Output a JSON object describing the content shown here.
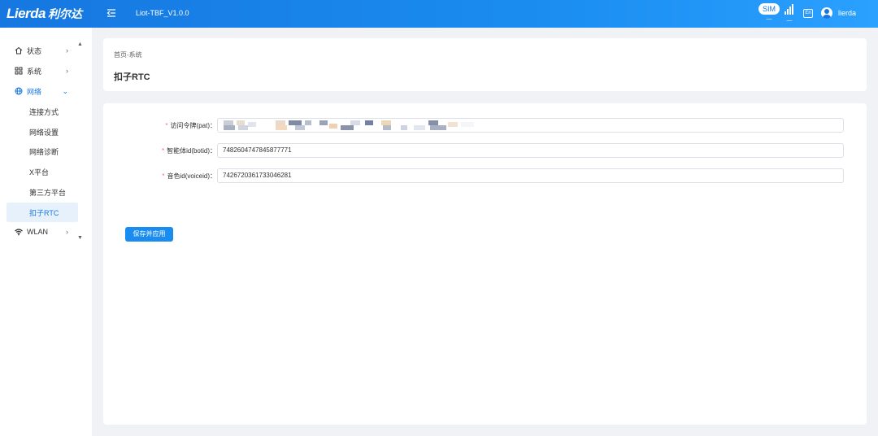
{
  "brand": {
    "logo_en": "Lierda",
    "logo_cn": "利尔达"
  },
  "header": {
    "app_version": "Liot-TBF_V1.0.0",
    "sim_label": "SIM",
    "sim_value": "—",
    "signal_value": "—",
    "lang_label": "En",
    "username": "lierda"
  },
  "sidebar": {
    "items": [
      {
        "label": "状态",
        "icon": "home-icon",
        "arrow": "›"
      },
      {
        "label": "系统",
        "icon": "grid-icon",
        "arrow": "›"
      },
      {
        "label": "网络",
        "icon": "globe-icon",
        "arrow": "⌄",
        "expanded": true
      },
      {
        "label": "WLAN",
        "icon": "wifi-icon",
        "arrow": "›"
      }
    ],
    "sub_items": [
      "连接方式",
      "网络设置",
      "网络诊断",
      "X平台",
      "第三方平台",
      "扣子RTC"
    ],
    "active_sub": "扣子RTC",
    "scroll_up": "▲",
    "scroll_down": "▼"
  },
  "page": {
    "breadcrumb": "首页-系统",
    "title": "扣子RTC"
  },
  "form": {
    "fields": [
      {
        "label": "访问令牌(pat)：",
        "required": true,
        "value": "",
        "redacted": true
      },
      {
        "label": "智能体id(botid)：",
        "required": true,
        "value": "7482604747845877771"
      },
      {
        "label": "音色id(voiceid)：",
        "required": true,
        "value": "7426720361733046281"
      }
    ],
    "required_mark": "*",
    "save_label": "保存并应用"
  },
  "colors": {
    "primary": "#1677e0",
    "active_bg": "#e6f1fc",
    "required": "#f56c6c",
    "page_bg": "#f0f2f5"
  }
}
